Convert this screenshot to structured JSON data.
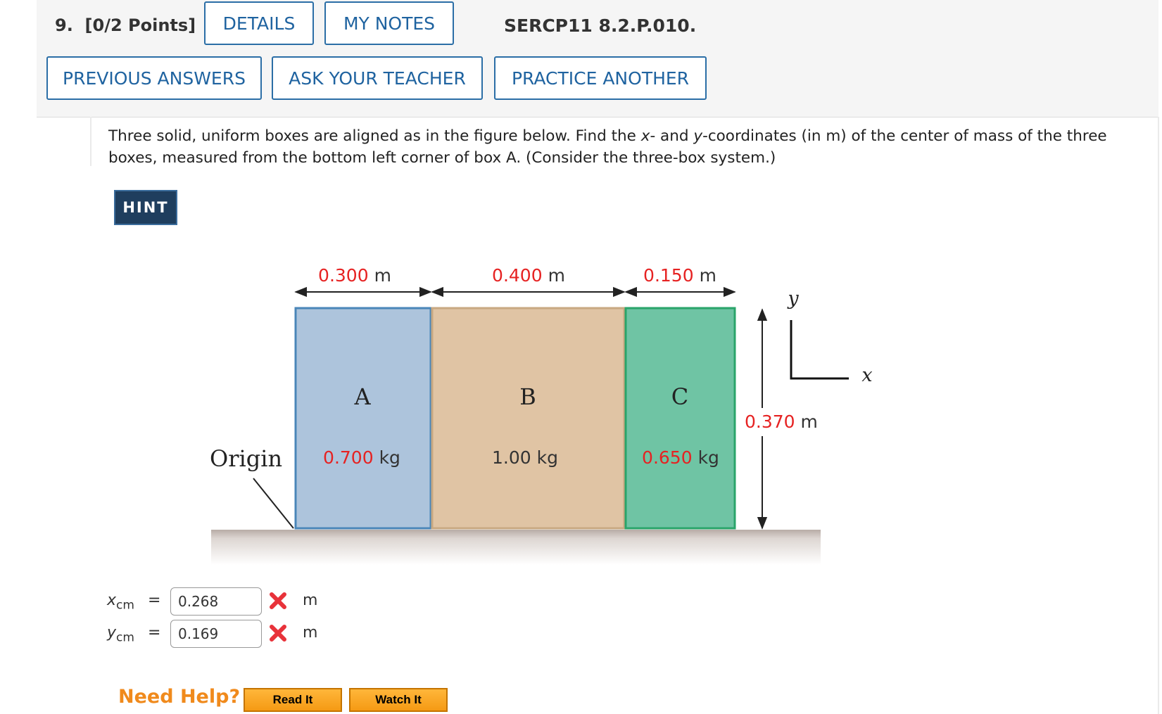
{
  "header": {
    "question_number": "9.",
    "points": "[0/2 Points]",
    "details_label": "DETAILS",
    "my_notes_label": "MY NOTES",
    "problem_code": "SERCP11 8.2.P.010.",
    "previous_answers_label": "PREVIOUS ANSWERS",
    "ask_teacher_label": "ASK YOUR TEACHER",
    "practice_another_label": "PRACTICE ANOTHER"
  },
  "question": {
    "text_1": "Three solid, uniform boxes are aligned as in the figure below. Find the ",
    "x_var": "x",
    "text_2": "- and ",
    "y_var": "y",
    "text_3": "-coordinates (in m) of the center of mass of the three boxes, measured from the bottom left corner of box A. (Consider the three-box system.)"
  },
  "hint_label": "HINT",
  "figure": {
    "dim_a_value": "0.300",
    "dim_b_value": "0.400",
    "dim_c_value": "0.150",
    "dim_unit": "m",
    "height_value": "0.370",
    "height_unit": "m",
    "box_a": {
      "label": "A",
      "mass_value": "0.700",
      "mass_unit": "kg",
      "color": "#adc4dc"
    },
    "box_b": {
      "label": "B",
      "mass_text": "1.00 kg",
      "color": "#e0c4a4"
    },
    "box_c": {
      "label": "C",
      "mass_value": "0.650",
      "mass_unit": "kg",
      "color": "#6fc4a4"
    },
    "origin_label": "Origin",
    "axis_y_label": "y",
    "axis_x_label": "x",
    "highlight_color": "#e62222"
  },
  "answers": {
    "x_var": "x",
    "x_sub": "cm",
    "x_value": "0.268",
    "y_var": "y",
    "y_sub": "cm",
    "y_value": "0.169",
    "equals": "=",
    "unit": "m",
    "status_icon": "incorrect-x-icon"
  },
  "help": {
    "need_help_label": "Need Help?",
    "read_it_label": "Read It",
    "watch_it_label": "Watch It"
  }
}
